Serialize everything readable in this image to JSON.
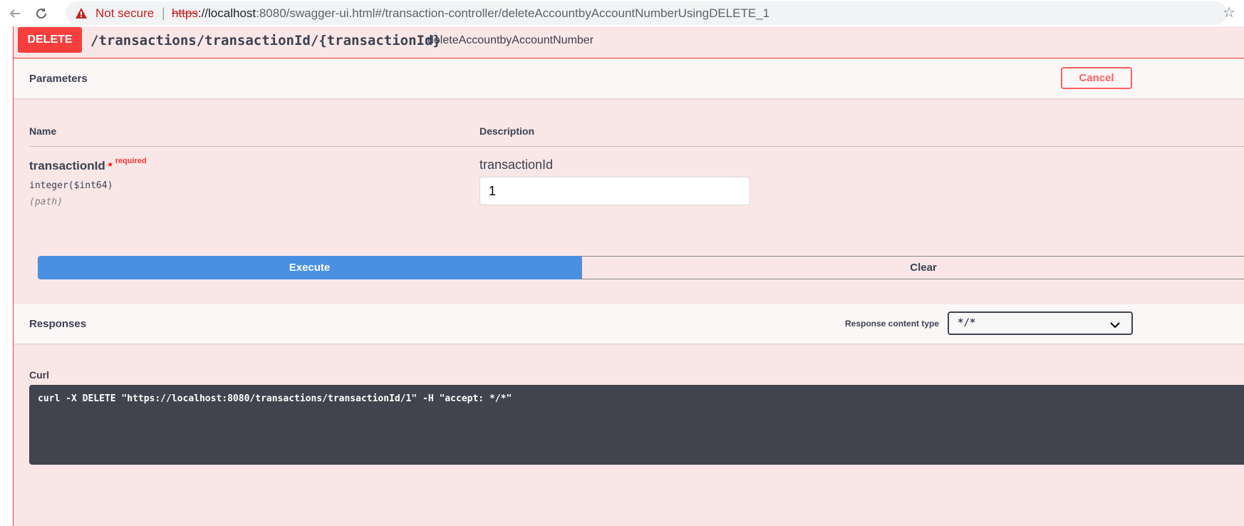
{
  "browser": {
    "security_label": "Not secure",
    "url_scheme": "https",
    "url_host": "://localhost",
    "url_rest": ":8080/swagger-ui.html#/transaction-controller/deleteAccountbyAccountNumberUsingDELETE_1"
  },
  "operation": {
    "method": "DELETE",
    "path": "/transactions/transactionId/{transactionId}",
    "operation_id": "deleteAccountbyAccountNumber"
  },
  "parameters": {
    "title": "Parameters",
    "cancel_label": "Cancel",
    "col_name": "Name",
    "col_description": "Description",
    "items": [
      {
        "name": "transactionId",
        "required_star": "*",
        "required_label": "required",
        "type": "integer($int64)",
        "location": "(path)",
        "description": "transactionId",
        "value": "1"
      }
    ]
  },
  "actions": {
    "execute_label": "Execute",
    "clear_label": "Clear"
  },
  "responses": {
    "title": "Responses",
    "content_type_label": "Response content type",
    "content_type_value": "*/*"
  },
  "curl": {
    "label": "Curl",
    "command": "curl -X DELETE \"https://localhost:8080/transactions/transactionId/1\" -H \"accept: */*\""
  },
  "colors": {
    "delete_method": "#f93e3e",
    "execute": "#4990e2",
    "curl_background": "#41444e",
    "panel_background": "#f9e7e7"
  },
  "icons": [
    "back-arrow-icon",
    "reload-icon",
    "warning-icon",
    "star-icon",
    "chevron-down-icon"
  ]
}
